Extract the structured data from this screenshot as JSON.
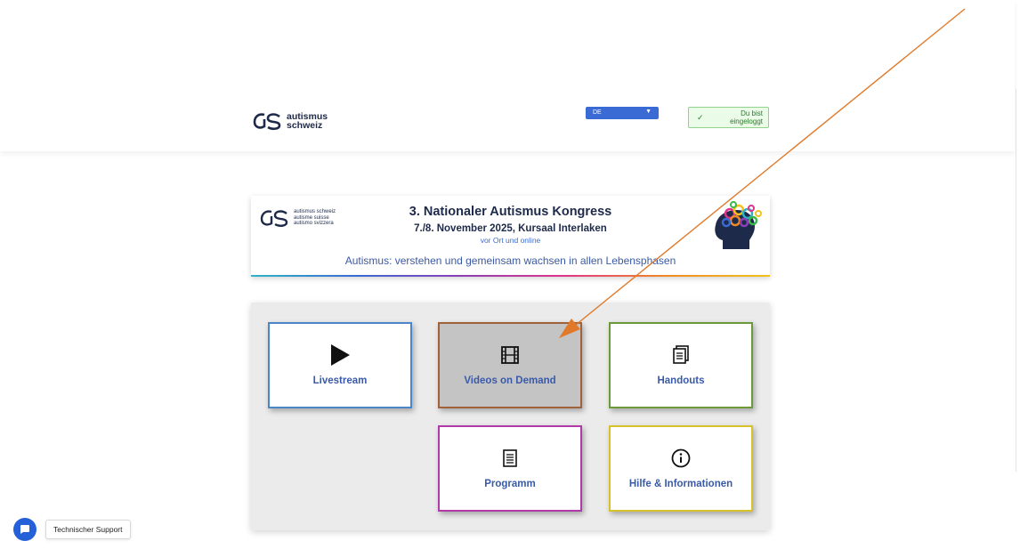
{
  "header": {
    "brand_line1": "autismus",
    "brand_line2": "schweiz",
    "language": "DE",
    "login_status_line1": "Du bist",
    "login_status_line2": "eingeloggt"
  },
  "banner": {
    "org_names": [
      "autismus schweiz",
      "autisme suisse",
      "autismo svizzera"
    ],
    "title": "3. Nationaler Autismus Kongress",
    "date_location": "7./8. November 2025, Kursaal Interlaken",
    "format": "vor Ort und online",
    "motto": "Autismus: verstehen und gemeinsam wachsen in allen Lebensphasen"
  },
  "tiles": {
    "livestream": {
      "label": "Livestream",
      "icon": "play-icon"
    },
    "videos": {
      "label": "Videos on Demand",
      "icon": "film-icon"
    },
    "handouts": {
      "label": "Handouts",
      "icon": "documents-icon"
    },
    "programm": {
      "label": "Programm",
      "icon": "document-list-icon"
    },
    "help": {
      "label": "Hilfe & Informationen",
      "icon": "info-icon"
    }
  },
  "support": {
    "label": "Technischer Support",
    "icon": "chat-bubble-icon"
  },
  "colors": {
    "brand_blue": "#3a6bd4",
    "title_navy": "#1e2a4a",
    "tile_label": "#3a5aa8",
    "annotation_arrow": "#e07a2a"
  }
}
